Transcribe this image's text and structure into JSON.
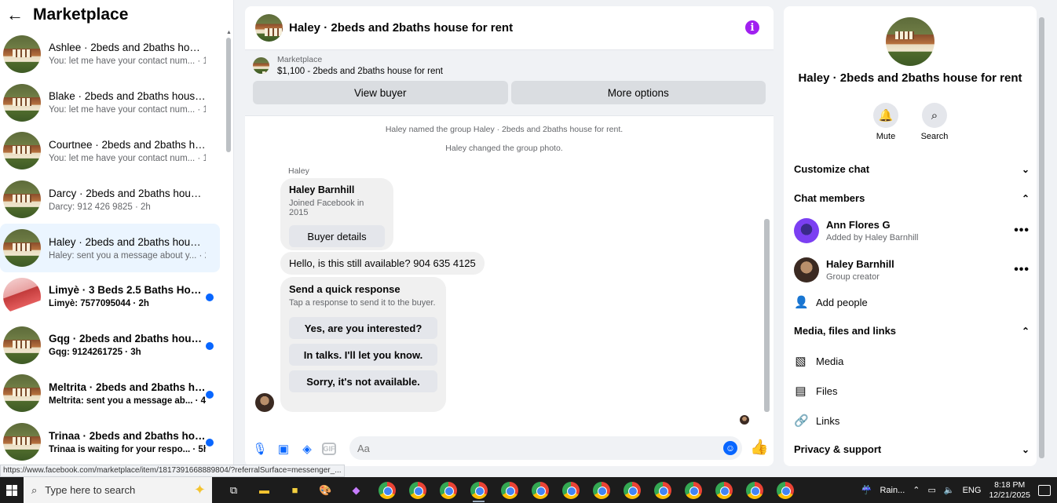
{
  "left": {
    "back_icon": "back-arrow-icon",
    "title": "Marketplace",
    "threads": [
      {
        "title": "Ashlee · 2beds and 2baths hous...",
        "sub": "You: let me have your contact num... · 1h",
        "unread": false,
        "active": false,
        "avatar": "house"
      },
      {
        "title": "Blake · 2beds and 2baths house ...",
        "sub": "You: let me have your contact num... · 1h",
        "unread": false,
        "active": false,
        "avatar": "house"
      },
      {
        "title": "Courtnee · 2beds and 2baths ho...",
        "sub": "You: let me have your contact num... · 1h",
        "unread": false,
        "active": false,
        "avatar": "house"
      },
      {
        "title": "Darcy · 2beds and 2baths house ...",
        "sub": "Darcy: 912 426 9825 · 2h",
        "unread": false,
        "active": false,
        "avatar": "house"
      },
      {
        "title": "Haley · 2beds and 2baths house ...",
        "sub": "Haley: sent you a message about y... · 2h",
        "unread": false,
        "active": true,
        "avatar": "house"
      },
      {
        "title": "Limyè · 3 Beds 2.5 Baths House",
        "sub": "Limyè: 7577095044 · 2h",
        "unread": true,
        "active": false,
        "avatar": "bedroom"
      },
      {
        "title": "Gqg · 2beds and 2baths house...",
        "sub": "Gqg: 9124261725 · 3h",
        "unread": true,
        "active": false,
        "avatar": "house"
      },
      {
        "title": "Meltrita · 2beds and 2baths ho...",
        "sub": "Meltrita: sent you a message ab... · 4h",
        "unread": true,
        "active": false,
        "avatar": "house"
      },
      {
        "title": "Trinaa · 2beds and 2baths hou...",
        "sub": "Trinaa is waiting for your respo... · 5h",
        "unread": true,
        "active": false,
        "avatar": "house"
      }
    ],
    "status_url": "https://www.facebook.com/marketplace/item/1817391668889804/?referralSurface=messenger_..."
  },
  "chat": {
    "title": "Haley · 2beds and 2baths house for rent",
    "listing_label": "Marketplace",
    "listing_price": "$1,100 - 2beds and 2baths house for rent",
    "view_buyer": "View buyer",
    "more_options": "More options",
    "sys1": "Haley named the group Haley · 2beds and 2baths house for rent.",
    "sys2": "Haley changed the group photo.",
    "sender": "Haley",
    "profile_name": "Haley Barnhill",
    "profile_joined": "Joined Facebook in 2015",
    "buyer_details": "Buyer details",
    "message": "Hello, is this still available? 904 635 4125",
    "quick_title": "Send a quick response",
    "quick_sub": "Tap a response to send it to the buyer.",
    "quick_options": [
      "Yes, are you interested?",
      "In talks. I'll let you know.",
      "Sorry, it's not available."
    ],
    "input_placeholder": "Aa"
  },
  "right": {
    "title": "Haley · 2beds and 2baths house for rent",
    "mute": "Mute",
    "search": "Search",
    "customize": "Customize chat",
    "members_header": "Chat members",
    "members": [
      {
        "name": "Ann Flores G",
        "sub": "Added by Haley Barnhill"
      },
      {
        "name": "Haley Barnhill",
        "sub": "Group creator"
      }
    ],
    "add_people": "Add people",
    "media_header": "Media, files and links",
    "media": "Media",
    "files": "Files",
    "links": "Links",
    "privacy": "Privacy & support"
  },
  "taskbar": {
    "search_placeholder": "Type here to search",
    "weather": "Rain...",
    "lang": "ENG",
    "time": "8:18 PM",
    "date": "12/21/2025"
  },
  "colors": {
    "accent": "#0866ff",
    "info": "#a020f0",
    "active_thread": "#ebf5ff"
  }
}
